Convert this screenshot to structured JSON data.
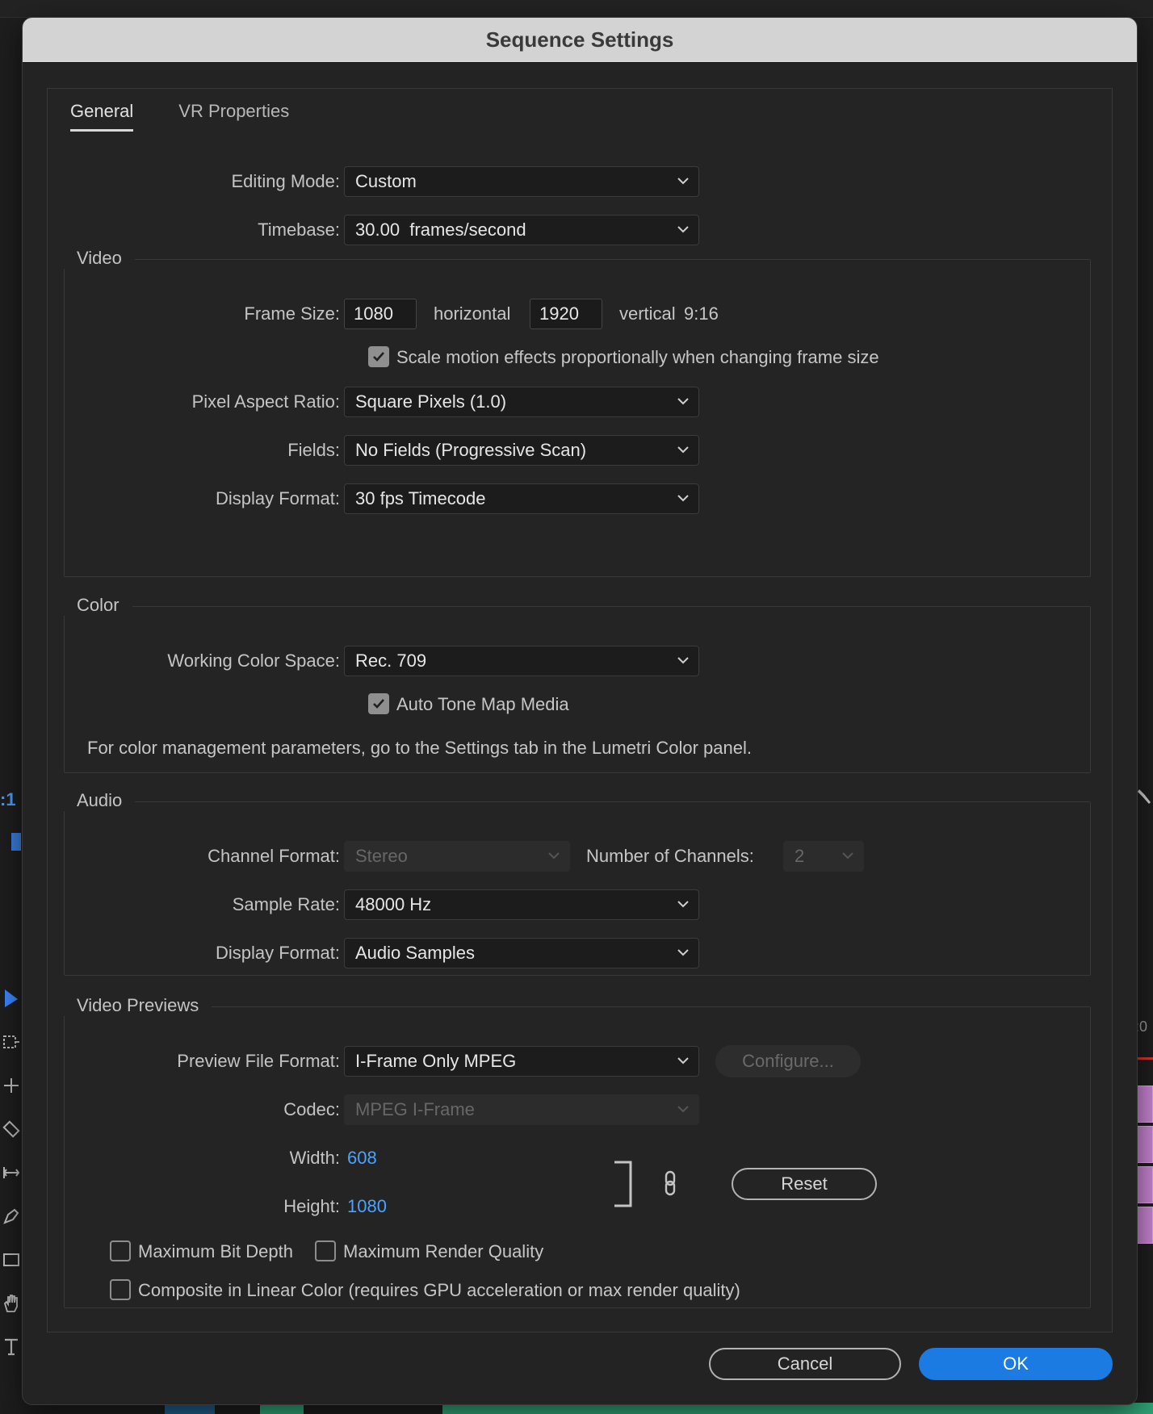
{
  "window": {
    "title": "Sequence Settings"
  },
  "background": {
    "timecode": ":1",
    "ruler_time": ":0"
  },
  "tabs": [
    {
      "label": "General"
    },
    {
      "label": "VR Properties"
    }
  ],
  "general": {
    "editing_mode": {
      "label": "Editing Mode:",
      "value": "Custom"
    },
    "timebase": {
      "label": "Timebase:",
      "value": "30.00  frames/second"
    }
  },
  "video": {
    "title": "Video",
    "frame_size": {
      "label": "Frame Size:",
      "horizontal": "1080",
      "horizontal_label": "horizontal",
      "vertical": "1920",
      "vertical_label": "vertical",
      "aspect": "9:16"
    },
    "scale_motion": {
      "label": "Scale motion effects proportionally when changing frame size",
      "checked": true
    },
    "pixel_aspect": {
      "label": "Pixel Aspect Ratio:",
      "value": "Square Pixels (1.0)"
    },
    "fields": {
      "label": "Fields:",
      "value": "No Fields (Progressive Scan)"
    },
    "display_format": {
      "label": "Display Format:",
      "value": "30 fps Timecode"
    }
  },
  "color": {
    "title": "Color",
    "working_space": {
      "label": "Working Color Space:",
      "value": "Rec. 709"
    },
    "auto_tone_map": {
      "label": "Auto Tone Map Media",
      "checked": true
    },
    "note": "For color management parameters, go to the Settings tab in the Lumetri Color panel."
  },
  "audio": {
    "title": "Audio",
    "channel_format": {
      "label": "Channel Format:",
      "value": "Stereo"
    },
    "num_channels": {
      "label": "Number of Channels:",
      "value": "2"
    },
    "sample_rate": {
      "label": "Sample Rate:",
      "value": "48000 Hz"
    },
    "display_format": {
      "label": "Display Format:",
      "value": "Audio Samples"
    }
  },
  "previews": {
    "title": "Video Previews",
    "file_format": {
      "label": "Preview File Format:",
      "value": "I-Frame Only MPEG"
    },
    "configure_label": "Configure...",
    "codec": {
      "label": "Codec:",
      "value": "MPEG I-Frame"
    },
    "width": {
      "label": "Width:",
      "value": "608"
    },
    "height": {
      "label": "Height:",
      "value": "1080"
    },
    "reset_label": "Reset",
    "max_bit_depth": {
      "label": "Maximum Bit Depth",
      "checked": false
    },
    "max_render_quality": {
      "label": "Maximum Render Quality",
      "checked": false
    },
    "linear_color": {
      "label": "Composite in Linear Color (requires GPU acceleration or max render quality)",
      "checked": false
    }
  },
  "footer": {
    "cancel_label": "Cancel",
    "ok_label": "OK"
  },
  "colors": {
    "accent": "#1c7ae3",
    "link_value": "#4ba3ff",
    "titlebar": "#d3d3d3",
    "dialog_bg": "#232323"
  }
}
